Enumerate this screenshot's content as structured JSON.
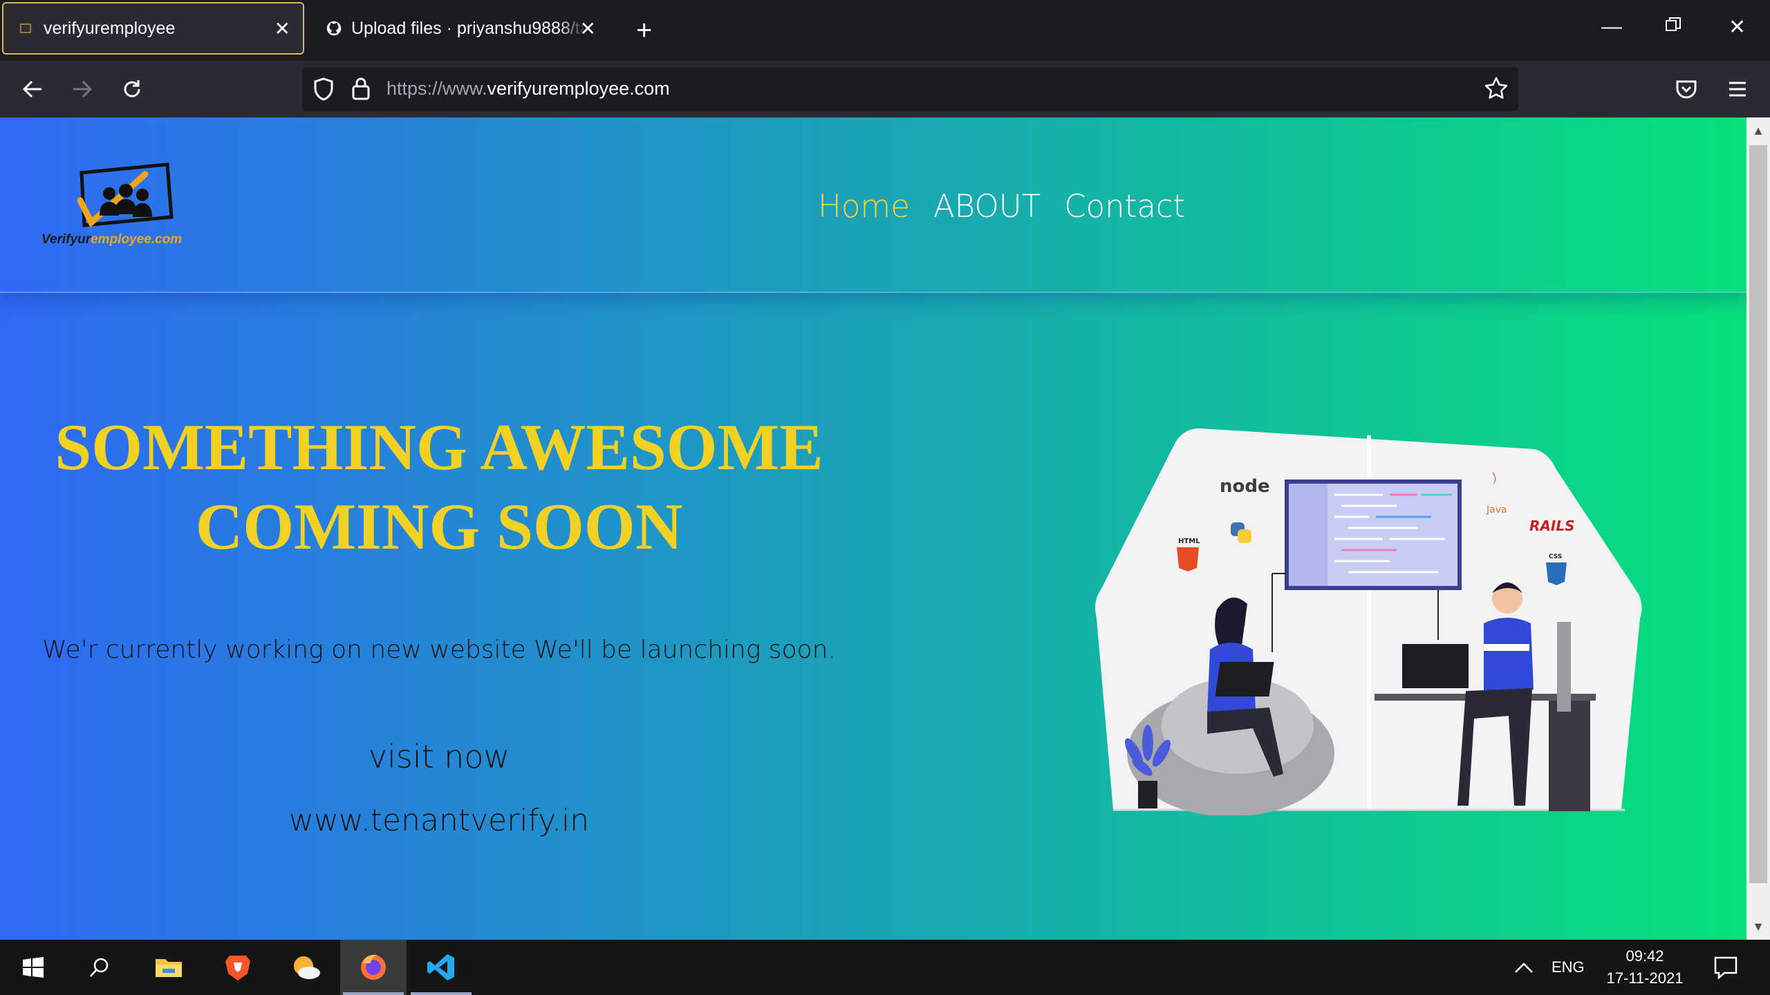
{
  "browser": {
    "tabs": [
      {
        "title": "verifyuremployee",
        "active": true
      },
      {
        "title": "Upload files · priyanshu9888/ta",
        "active": false
      }
    ],
    "url": {
      "prefix": "https://www.",
      "domain": "verifyuremployee.com"
    }
  },
  "site": {
    "logo": {
      "text_main": "Verifyur",
      "text_accent": "employee.com"
    },
    "nav": [
      {
        "label": "Home",
        "current": true
      },
      {
        "label": "ABOUT",
        "current": false
      },
      {
        "label": "Contact",
        "current": false
      }
    ],
    "hero": {
      "title_line1": "SOMETHING AWESOME",
      "title_line2": "COMING SOON",
      "subtitle": "We'r currently working on new website We'll be launching soon.",
      "visit_label": "visit now",
      "visit_url": "www.tenantverify.in"
    },
    "illustration": {
      "labels": {
        "node": "node",
        "html": "HTML",
        "java": "Java",
        "rails": "RAILS",
        "css": "CSS"
      }
    },
    "colors": {
      "gradient_start": "#2f69f3",
      "gradient_end": "#06e07a",
      "accent_yellow": "#f1d224"
    }
  },
  "taskbar": {
    "language": "ENG",
    "time": "09:42",
    "date": "17-11-2021"
  }
}
